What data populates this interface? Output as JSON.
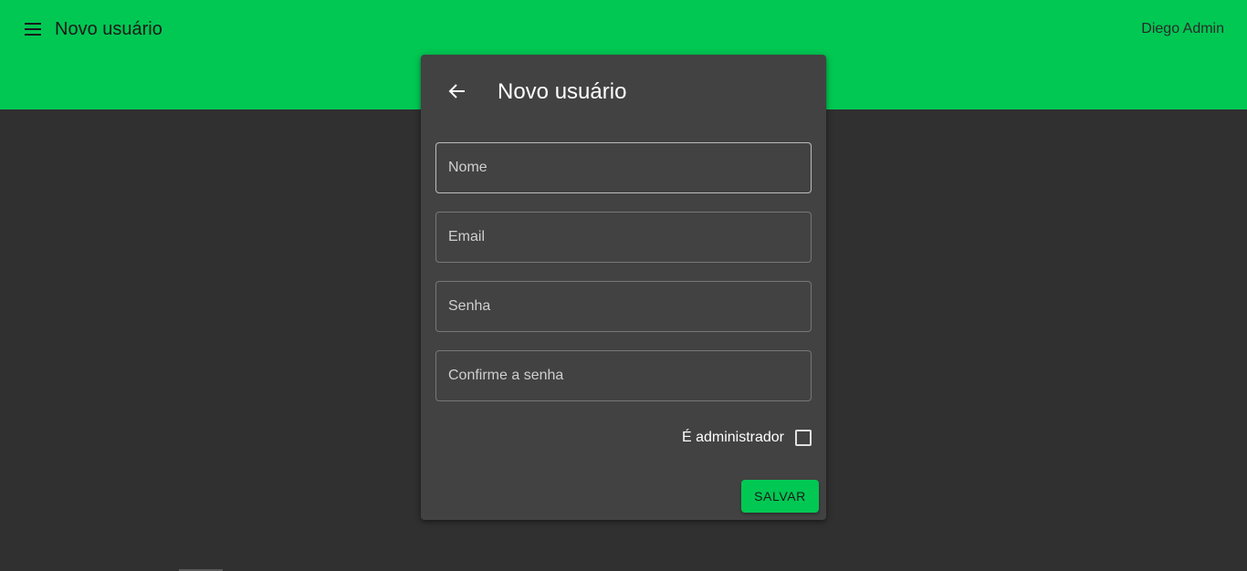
{
  "header": {
    "menu_icon": "hamburger-menu-icon",
    "title": "Novo usuário",
    "user_name": "Diego Admin",
    "background_color": "#00c853"
  },
  "card": {
    "back_icon": "arrow-left-icon",
    "title": "Novo usuário",
    "fields": [
      {
        "placeholder": "Nome",
        "value": ""
      },
      {
        "placeholder": "Email",
        "value": ""
      },
      {
        "placeholder": "Senha",
        "value": ""
      },
      {
        "placeholder": "Confirme a senha",
        "value": ""
      }
    ],
    "admin_checkbox": {
      "label": "É administrador",
      "checked": false
    },
    "save_label": "SALVAR"
  },
  "colors": {
    "accent": "#00c853",
    "page_background": "#303030",
    "card_background": "#424242"
  }
}
